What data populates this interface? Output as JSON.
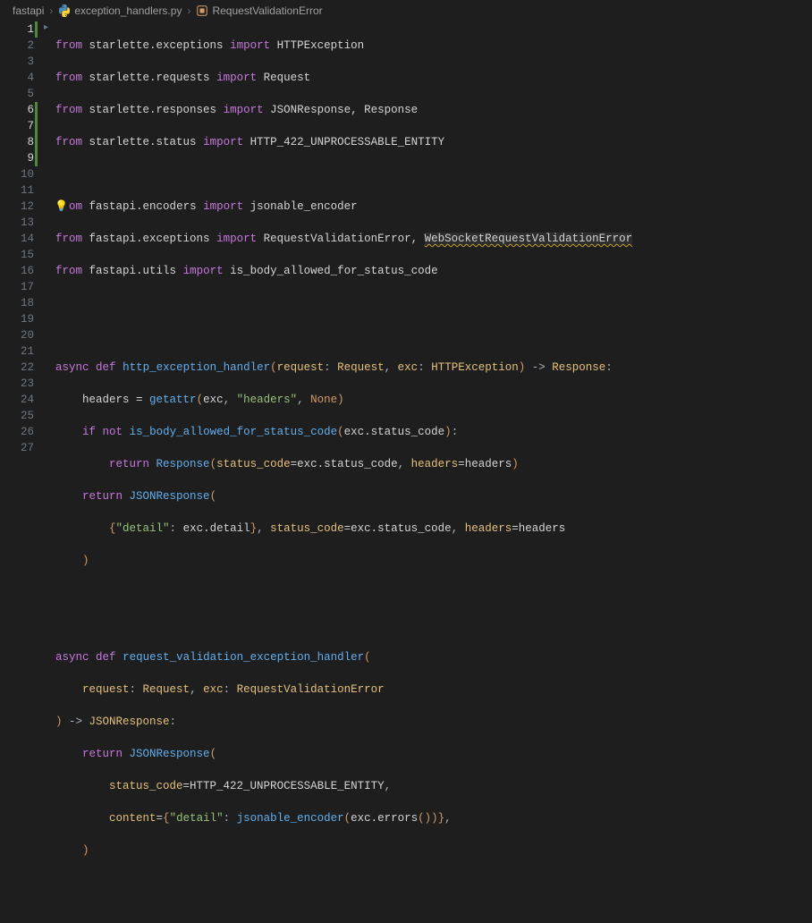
{
  "breadcrumb": {
    "root": "fastapi",
    "file": "exception_handlers.py",
    "symbol": "RequestValidationError"
  },
  "gutter": {
    "lines": [
      "1",
      "2",
      "3",
      "4",
      "5",
      "6",
      "7",
      "8",
      "9",
      "10",
      "11",
      "12",
      "13",
      "14",
      "15",
      "16",
      "17",
      "18",
      "19",
      "20",
      "21",
      "22",
      "23",
      "24",
      "25",
      "26",
      "27"
    ],
    "modified": [
      1,
      6,
      7,
      8,
      9
    ]
  },
  "code": {
    "l1": {
      "from": "from",
      "m": "starlette.exceptions",
      "imp": "import",
      "names": "HTTPException"
    },
    "l2": {
      "from": "from",
      "m": "starlette.requests",
      "imp": "import",
      "names": "Request"
    },
    "l3": {
      "from": "from",
      "m": "starlette.responses",
      "imp": "import",
      "names": "JSONResponse, Response"
    },
    "l4": {
      "from": "from",
      "m": "starlette.status",
      "imp": "import",
      "names": "HTTP_422_UNPROCESSABLE_ENTITY"
    },
    "l6": {
      "partial": "om",
      "m": "fastapi.encoders",
      "imp": "import",
      "names": "jsonable_encoder"
    },
    "l7": {
      "from": "from",
      "m": "fastapi.exceptions",
      "imp": "import",
      "n1": "RequestValidationError, ",
      "n2": "WebSocketRequestValidationError"
    },
    "l8": {
      "from": "from",
      "m": "fastapi.utils",
      "imp": "import",
      "names": "is_body_allowed_for_status_code"
    },
    "l11": {
      "async": "async",
      "def": "def",
      "fn": "http_exception_handler",
      "p1": "request",
      "t1": "Request",
      "p2": "exc",
      "t2": "HTTPException",
      "ret": "Response"
    },
    "l12": {
      "var": "headers",
      "eq": " = ",
      "fn": "getattr",
      "a1": "exc",
      "a2": "\"headers\"",
      "a3": "None"
    },
    "l13": {
      "if": "if",
      "not": "not",
      "fn": "is_body_allowed_for_status_code",
      "arg": "exc.status_code"
    },
    "l14": {
      "ret": "return",
      "fn": "Response",
      "k1": "status_code",
      "v1": "exc.status_code",
      "k2": "headers",
      "v2": "headers"
    },
    "l15": {
      "ret": "return",
      "fn": "JSONResponse"
    },
    "l16": {
      "key": "\"detail\"",
      "val": "exc.detail",
      "k1": "status_code",
      "v1": "exc.status_code",
      "k2": "headers",
      "v2": "headers"
    },
    "l17": {
      "close": ")"
    },
    "l20": {
      "async": "async",
      "def": "def",
      "fn": "request_validation_exception_handler"
    },
    "l21": {
      "p1": "request",
      "t1": "Request",
      "p2": "exc",
      "t2": "RequestValidationError"
    },
    "l22": {
      "close": ")",
      "arrow": " -> ",
      "ret": "JSONResponse"
    },
    "l23": {
      "ret": "return",
      "fn": "JSONResponse"
    },
    "l24": {
      "k": "status_code",
      "v": "HTTP_422_UNPROCESSABLE_ENTITY"
    },
    "l25": {
      "k": "content",
      "key": "\"detail\"",
      "fn": "jsonable_encoder",
      "arg": "exc.errors"
    },
    "l26": {
      "close": ")"
    }
  },
  "icons": {
    "bulb": "💡"
  }
}
